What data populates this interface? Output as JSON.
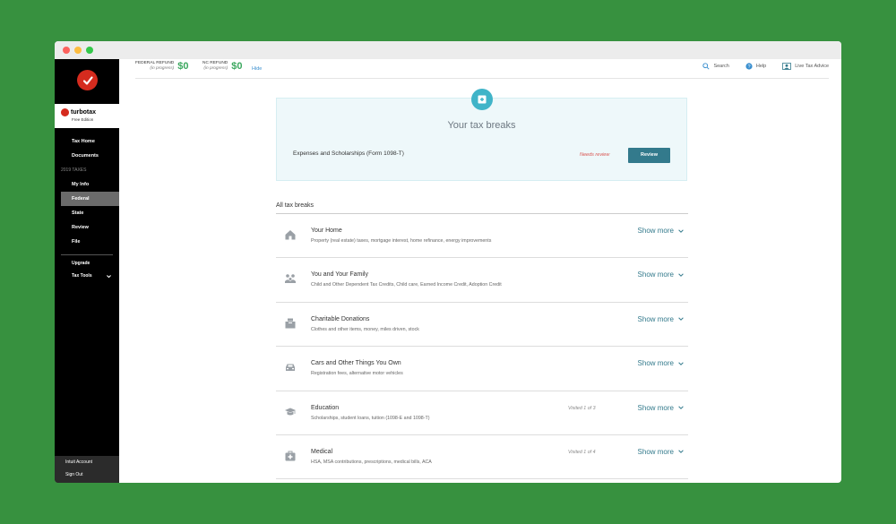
{
  "sidebar": {
    "brand_name": "turbotax",
    "brand_edition": "Free Edition",
    "nav": [
      {
        "label": "Tax Home"
      },
      {
        "label": "Documents"
      }
    ],
    "section_label": "2019 TAXES",
    "tax_nav": [
      {
        "label": "My Info"
      },
      {
        "label": "Federal",
        "active": true
      },
      {
        "label": "State"
      },
      {
        "label": "Review"
      },
      {
        "label": "File"
      }
    ],
    "upgrade_label": "Upgrade",
    "tax_tools_label": "Tax Tools",
    "intuit_account_label": "Intuit Account",
    "sign_out_label": "Sign Out"
  },
  "topbar": {
    "federal_refund_label": "FEDERAL REFUND",
    "federal_refund_note": "(in progress)",
    "federal_refund_value": "$0",
    "nc_refund_label": "NC REFUND",
    "nc_refund_note": "(in progress)",
    "nc_refund_value": "$0",
    "hide_label": "Hide",
    "search_label": "Search",
    "help_label": "Help",
    "live_advice_label": "Live Tax Advice"
  },
  "card": {
    "title": "Your tax breaks",
    "item_label": "Expenses and Scholarships (Form 1098-T)",
    "status": "Needs review",
    "button_label": "Review"
  },
  "all_breaks_label": "All tax breaks",
  "show_more_label": "Show more",
  "categories": [
    {
      "title": "Your Home",
      "desc": "Property (real estate) taxes, mortgage interest, home refinance, energy improvements",
      "visited": "",
      "icon": "home-icon"
    },
    {
      "title": "You and Your Family",
      "desc": "Child and Other Dependent Tax Credits, Child care, Earned Income Credit, Adoption Credit",
      "visited": "",
      "icon": "family-icon"
    },
    {
      "title": "Charitable Donations",
      "desc": "Clothes and other items, money, miles driven, stock",
      "visited": "",
      "icon": "donation-box-icon"
    },
    {
      "title": "Cars and Other Things You Own",
      "desc": "Registration fees, alternative motor vehicles",
      "visited": "",
      "icon": "car-icon"
    },
    {
      "title": "Education",
      "desc": "Scholarships, student loans, tuition (1098-E and 1098-T)",
      "visited": "Visited 1 of 3",
      "icon": "graduation-cap-icon"
    },
    {
      "title": "Medical",
      "desc": "HSA, MSA contributions, prescriptions, medical bills, ACA",
      "visited": "Visited 1 of 4",
      "icon": "medical-kit-icon"
    }
  ],
  "colors": {
    "background": "#37913f",
    "sidebar": "#000000",
    "accent_teal": "#337a8c",
    "refund_green": "#3ca85f",
    "needs_review": "#d9534f",
    "brand_red": "#d52b1e"
  }
}
